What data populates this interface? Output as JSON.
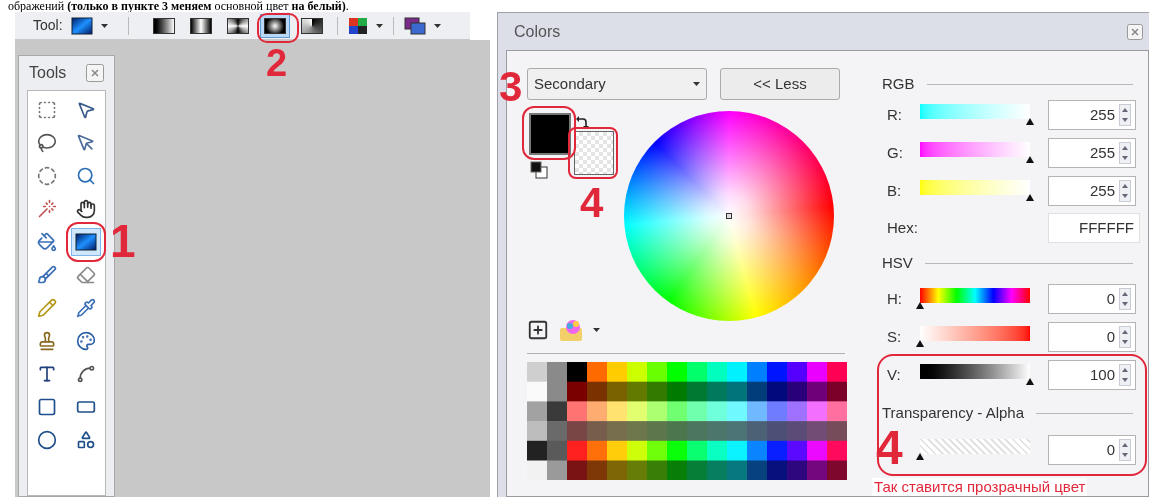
{
  "instruction_line": "ображений **(только в пункте 3 меняем** основной цвет **на белый)**.",
  "toolbar": {
    "label": "Tool:",
    "gradient_types": [
      {
        "kind": "linear",
        "selected": false
      },
      {
        "kind": "reflected",
        "selected": false
      },
      {
        "kind": "diamond",
        "selected": false
      },
      {
        "kind": "radial",
        "selected": true
      },
      {
        "kind": "conical",
        "selected": false
      }
    ]
  },
  "tools_panel": {
    "title": "Tools",
    "tools": [
      {
        "kind": "rect-select",
        "selected": false
      },
      {
        "kind": "move-selected",
        "selected": false
      },
      {
        "kind": "lasso-select",
        "selected": false
      },
      {
        "kind": "move-selection",
        "selected": false
      },
      {
        "kind": "ellipse-select",
        "selected": false
      },
      {
        "kind": "zoom",
        "selected": false
      },
      {
        "kind": "magic-wand",
        "selected": false
      },
      {
        "kind": "pan",
        "selected": false
      },
      {
        "kind": "paint-bucket",
        "selected": false
      },
      {
        "kind": "gradient",
        "selected": true
      },
      {
        "kind": "paintbrush",
        "selected": false
      },
      {
        "kind": "eraser",
        "selected": false
      },
      {
        "kind": "pencil",
        "selected": false
      },
      {
        "kind": "color-picker",
        "selected": false
      },
      {
        "kind": "clone-stamp",
        "selected": false
      },
      {
        "kind": "recolor",
        "selected": false
      },
      {
        "kind": "text",
        "selected": false
      },
      {
        "kind": "line-curve",
        "selected": false
      },
      {
        "kind": "rectangle",
        "selected": false
      },
      {
        "kind": "rounded-rectangle",
        "selected": false
      },
      {
        "kind": "ellipse",
        "selected": false
      },
      {
        "kind": "freeform-shape",
        "selected": false
      }
    ]
  },
  "colors_window": {
    "title": "Colors",
    "mode_dropdown": {
      "value": "Secondary"
    },
    "less_button": "<< Less",
    "rgb": {
      "heading": "RGB",
      "channels": [
        {
          "kind": "red",
          "label": "R:",
          "level": 1,
          "value": "255"
        },
        {
          "kind": "green",
          "label": "G:",
          "level": 1,
          "value": "255"
        },
        {
          "kind": "blue",
          "label": "B:",
          "level": 1,
          "value": "255"
        }
      ]
    },
    "hex": {
      "label": "Hex:",
      "value": "FFFFFF"
    },
    "hsv": {
      "heading": "HSV",
      "channels": [
        {
          "kind": "hue",
          "label": "H:",
          "level": 0,
          "value": "0"
        },
        {
          "kind": "saturation",
          "label": "S:",
          "level": 0,
          "value": "0"
        },
        {
          "kind": "value",
          "label": "V:",
          "level": 1,
          "value": "100"
        }
      ]
    },
    "alpha": {
      "heading": "Transparency - Alpha",
      "kind": "alpha",
      "level": 0,
      "value": "0"
    }
  },
  "annotations": [
    {
      "kind": "marker",
      "text": "1"
    },
    {
      "kind": "marker",
      "text": "2"
    },
    {
      "kind": "marker",
      "text": "3"
    },
    {
      "kind": "marker",
      "text": "4"
    },
    {
      "kind": "marker",
      "text": "4"
    },
    {
      "kind": "caption",
      "text": "Так ставится прозрачный цвет"
    }
  ]
}
